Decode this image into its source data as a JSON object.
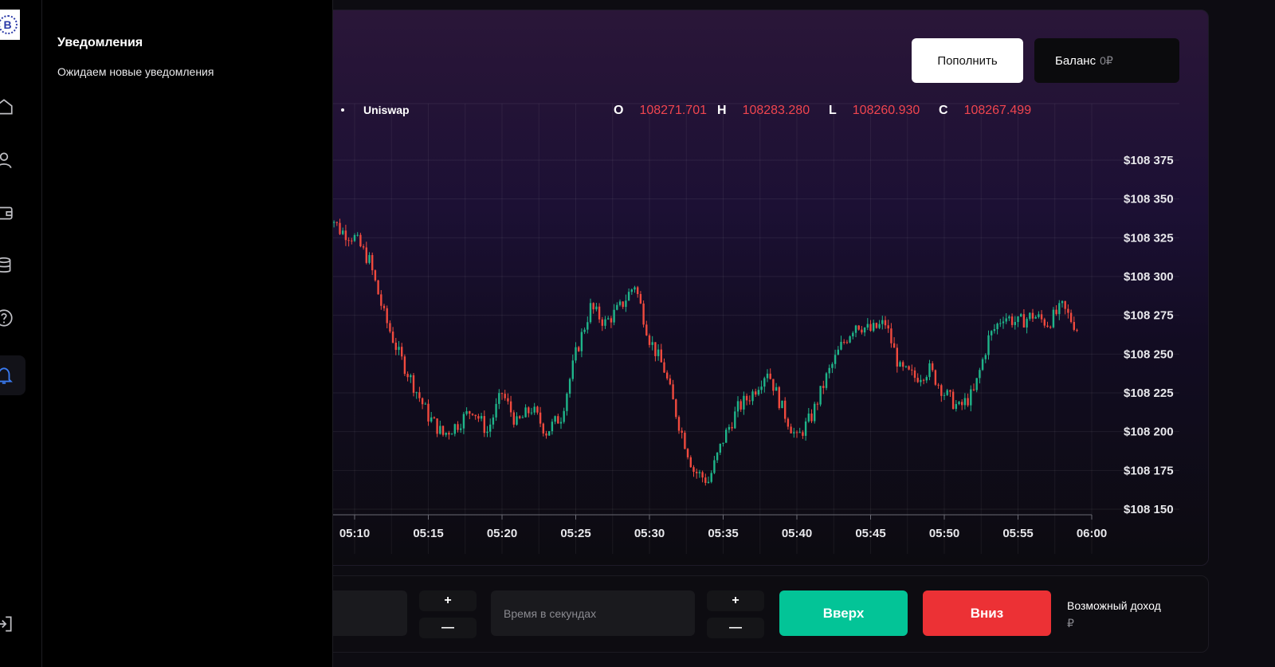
{
  "header": {
    "deposit_label": "Пополнить",
    "balance_label": "Баланс",
    "balance_value": "0₽"
  },
  "notifications": {
    "title": "Уведомления",
    "empty_text": "Ожидаем новые уведомления"
  },
  "chart_info": {
    "pair": "Uniswap",
    "ohlc": [
      {
        "key": "O",
        "value": "108271.701"
      },
      {
        "key": "H",
        "value": "108283.280"
      },
      {
        "key": "L",
        "value": "108260.930"
      },
      {
        "key": "C",
        "value": "108267.499"
      }
    ]
  },
  "chart_data": {
    "type": "candlestick",
    "title": "",
    "x_ticks": [
      "05:10",
      "05:15",
      "05:20",
      "05:25",
      "05:30",
      "05:35",
      "05:40",
      "05:45",
      "05:50",
      "05:55",
      "06:00"
    ],
    "y_ticks": [
      "$108 375",
      "$108 350",
      "$108 325",
      "$108 300",
      "$108 275",
      "$108 250",
      "$108 225",
      "$108 200",
      "$108 175",
      "$108 150"
    ],
    "ylim": [
      108150,
      108375
    ],
    "xlim_minutes": [
      "05:08",
      "06:00"
    ],
    "price_path": [
      {
        "t": "05:08",
        "p": 108345
      },
      {
        "t": "05:09",
        "p": 108330
      },
      {
        "t": "05:10",
        "p": 108325
      },
      {
        "t": "05:11",
        "p": 108310
      },
      {
        "t": "05:12",
        "p": 108275
      },
      {
        "t": "05:13",
        "p": 108250
      },
      {
        "t": "05:14",
        "p": 108230
      },
      {
        "t": "05:15",
        "p": 108210
      },
      {
        "t": "05:16",
        "p": 108198
      },
      {
        "t": "05:17",
        "p": 108205
      },
      {
        "t": "05:18",
        "p": 108215
      },
      {
        "t": "05:19",
        "p": 108200
      },
      {
        "t": "05:20",
        "p": 108225
      },
      {
        "t": "05:21",
        "p": 108205
      },
      {
        "t": "05:22",
        "p": 108215
      },
      {
        "t": "05:23",
        "p": 108200
      },
      {
        "t": "05:24",
        "p": 108210
      },
      {
        "t": "05:25",
        "p": 108250
      },
      {
        "t": "05:26",
        "p": 108280
      },
      {
        "t": "05:27",
        "p": 108270
      },
      {
        "t": "05:28",
        "p": 108280
      },
      {
        "t": "05:29",
        "p": 108295
      },
      {
        "t": "05:30",
        "p": 108260
      },
      {
        "t": "05:31",
        "p": 108240
      },
      {
        "t": "05:32",
        "p": 108205
      },
      {
        "t": "05:33",
        "p": 108175
      },
      {
        "t": "05:34",
        "p": 108168
      },
      {
        "t": "05:35",
        "p": 108195
      },
      {
        "t": "05:36",
        "p": 108215
      },
      {
        "t": "05:37",
        "p": 108225
      },
      {
        "t": "05:38",
        "p": 108240
      },
      {
        "t": "05:39",
        "p": 108215
      },
      {
        "t": "05:40",
        "p": 108195
      },
      {
        "t": "05:41",
        "p": 108210
      },
      {
        "t": "05:42",
        "p": 108235
      },
      {
        "t": "05:43",
        "p": 108255
      },
      {
        "t": "05:44",
        "p": 108270
      },
      {
        "t": "05:45",
        "p": 108265
      },
      {
        "t": "05:46",
        "p": 108270
      },
      {
        "t": "05:47",
        "p": 108240
      },
      {
        "t": "05:48",
        "p": 108235
      },
      {
        "t": "05:49",
        "p": 108240
      },
      {
        "t": "05:50",
        "p": 108225
      },
      {
        "t": "05:51",
        "p": 108215
      },
      {
        "t": "05:52",
        "p": 108225
      },
      {
        "t": "05:53",
        "p": 108260
      },
      {
        "t": "05:54",
        "p": 108275
      },
      {
        "t": "05:55",
        "p": 108270
      },
      {
        "t": "05:56",
        "p": 108275
      },
      {
        "t": "05:57",
        "p": 108270
      },
      {
        "t": "05:58",
        "p": 108280
      },
      {
        "t": "05:59",
        "p": 108267
      }
    ],
    "colors": {
      "up": "#1fb58a",
      "down": "#f04a3e"
    },
    "grid": true
  },
  "trade": {
    "time_placeholder": "Время в секундах",
    "plus": "+",
    "minus": "—",
    "up_label": "Вверх",
    "down_label": "Вниз",
    "income_label": "Возможный доход",
    "income_currency": "₽"
  }
}
